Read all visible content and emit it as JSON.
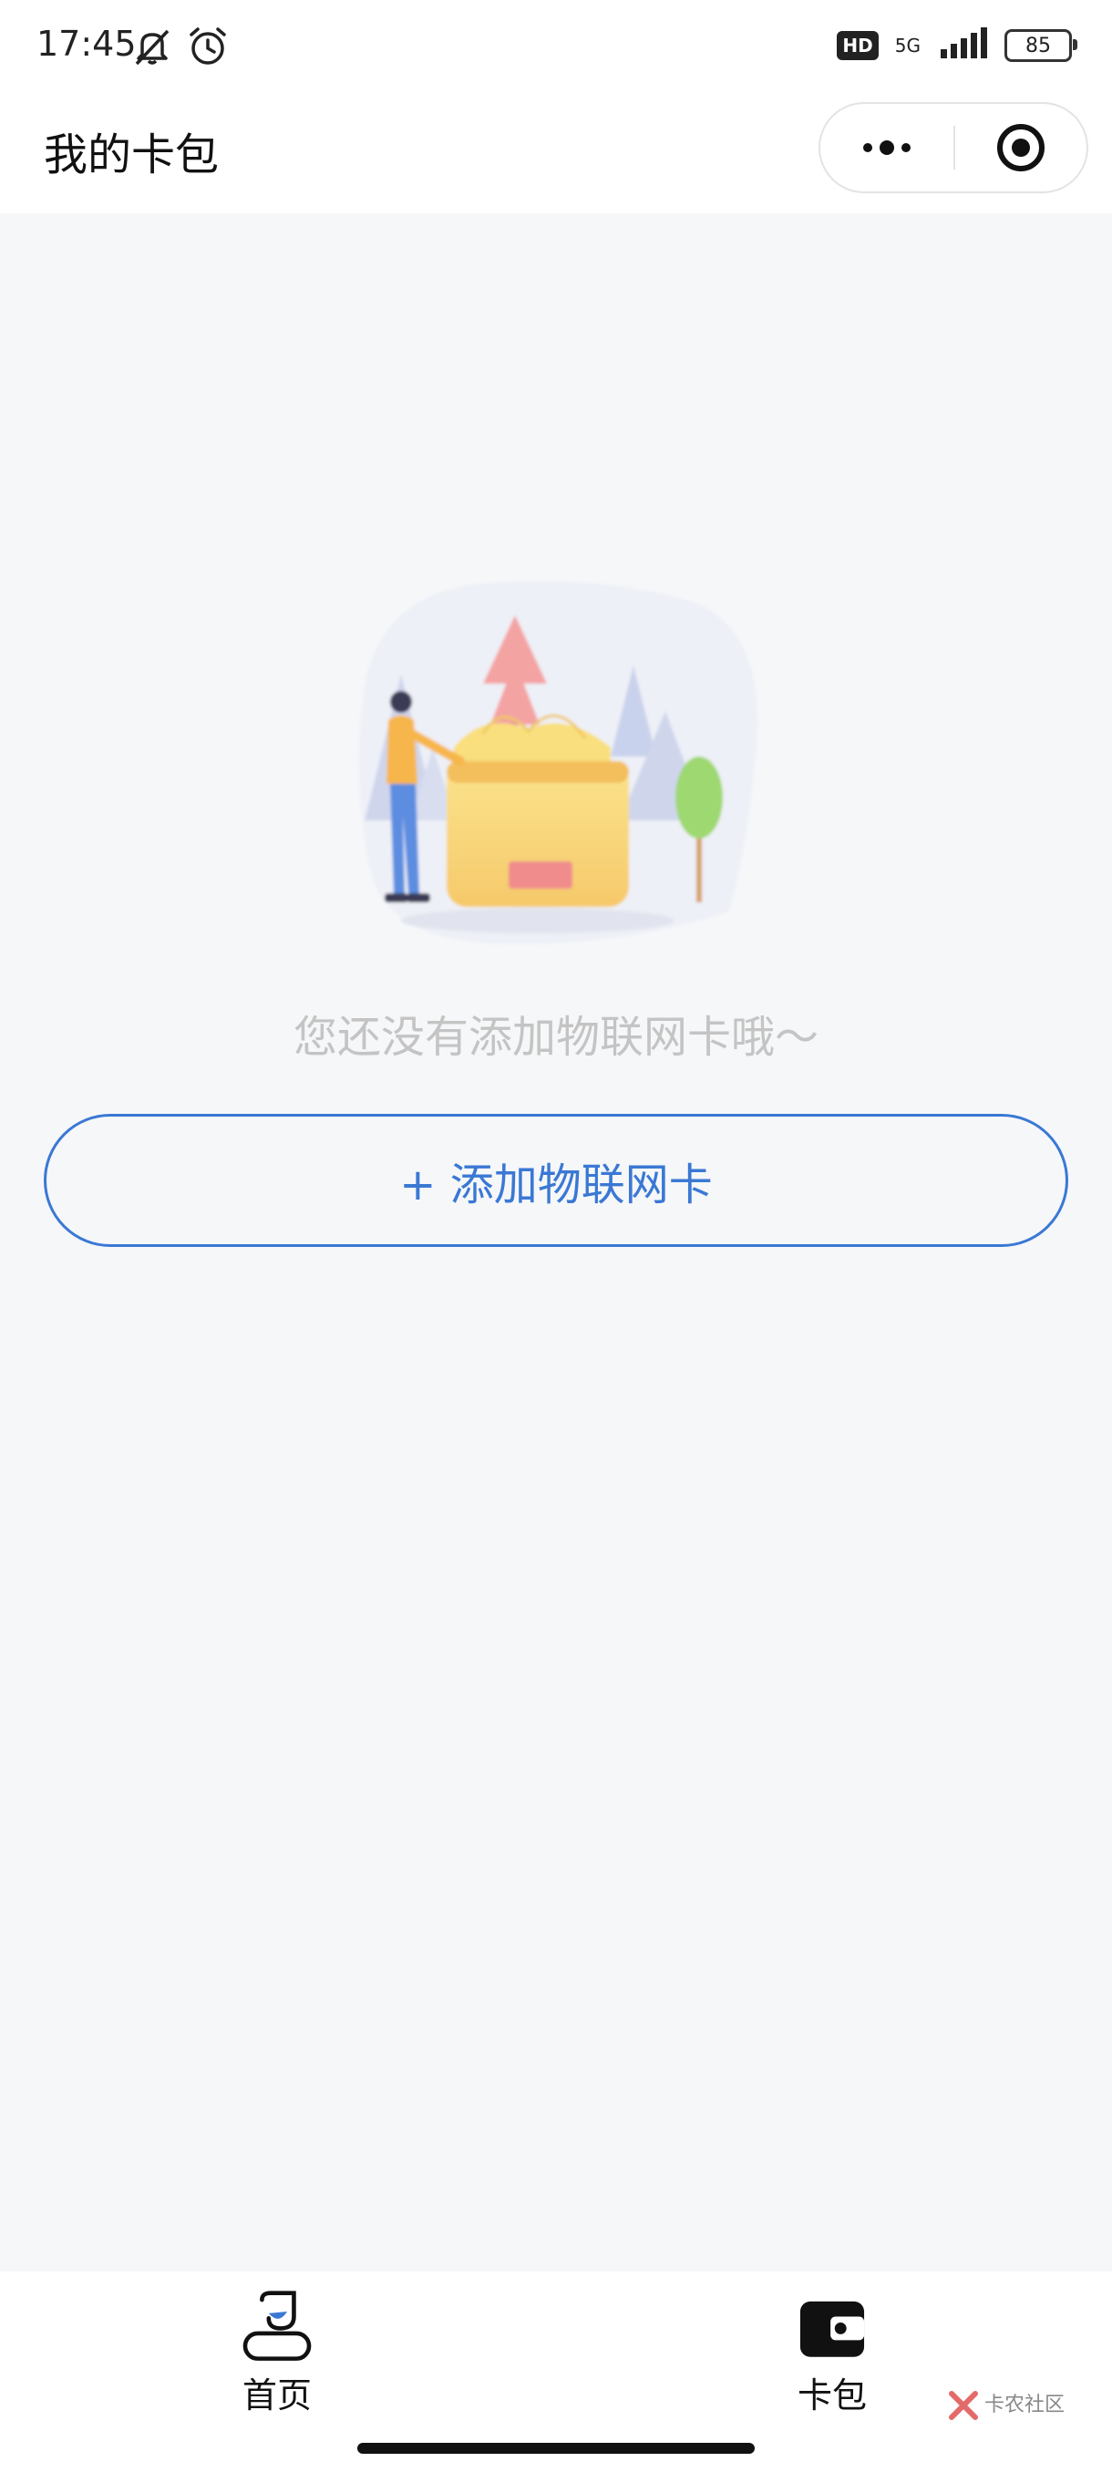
{
  "status_bar": {
    "time": "17:45",
    "hd_badge": "HD",
    "network": "5G",
    "battery": "85"
  },
  "header": {
    "title": "我的卡包"
  },
  "empty_state": {
    "message": "您还没有添加物联网卡哦～",
    "add_button_label": "+ 添加物联网卡"
  },
  "tab_bar": {
    "items": [
      {
        "label": "首页",
        "icon": "home-icon"
      },
      {
        "label": "卡包",
        "icon": "wallet-icon"
      }
    ]
  },
  "watermark": {
    "text": "卡农社区"
  },
  "colors": {
    "accent": "#3a78d4",
    "background": "#f6f7f9",
    "placeholder_text": "#c4c4c4"
  }
}
